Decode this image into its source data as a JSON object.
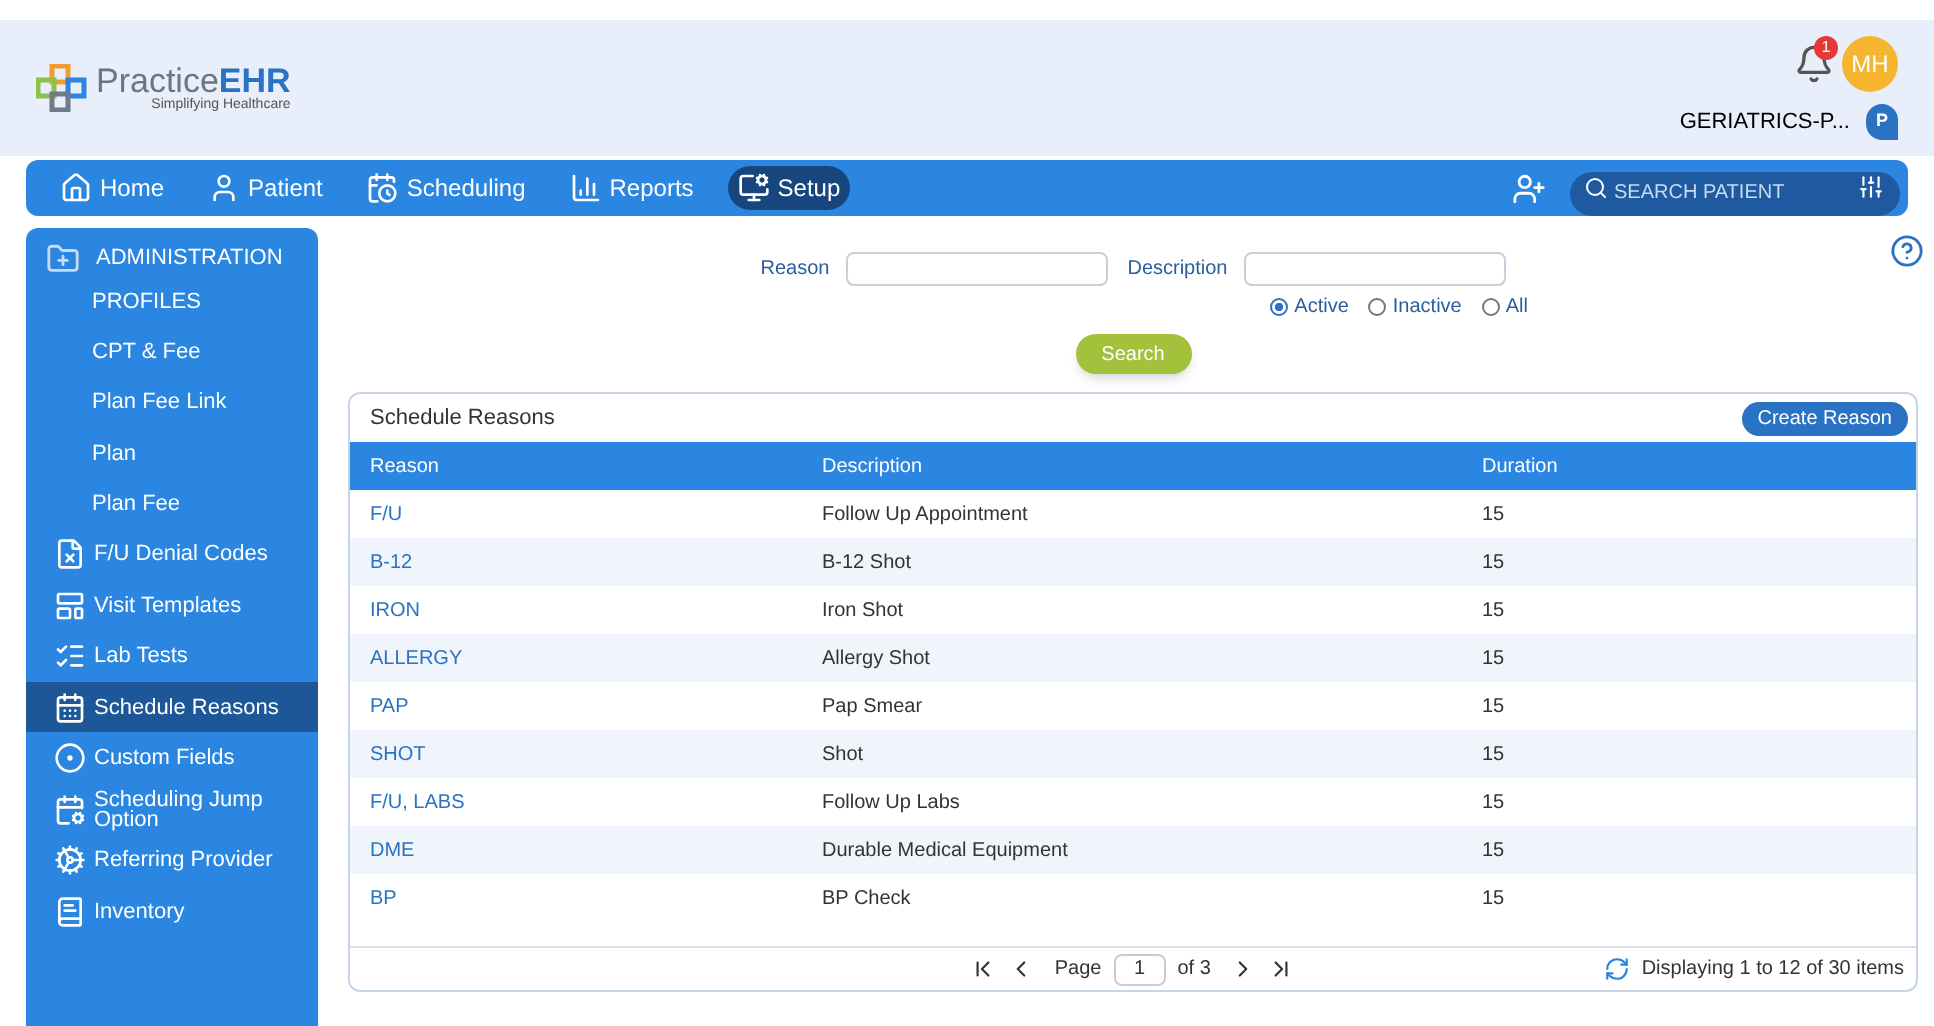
{
  "header": {
    "logo_main": "Practice",
    "logo_bold": "EHR",
    "tagline": "Simplifying Healthcare",
    "notifications": "1",
    "avatar": "MH",
    "facility": "GERIATRICS-P...",
    "facility_badge": "P"
  },
  "nav": {
    "items": [
      {
        "label": "Home",
        "selected": false
      },
      {
        "label": "Patient",
        "selected": false
      },
      {
        "label": "Scheduling",
        "selected": false
      },
      {
        "label": "Reports",
        "selected": false
      },
      {
        "label": "Setup",
        "selected": true
      }
    ],
    "search_placeholder": "SEARCH PATIENT"
  },
  "sidebar": {
    "heading": "ADMINISTRATION",
    "items": [
      {
        "label": "PROFILES",
        "selected": false
      },
      {
        "label": "CPT & Fee",
        "selected": false
      },
      {
        "label": "Plan Fee Link",
        "selected": false
      },
      {
        "label": "Plan",
        "selected": false
      },
      {
        "label": "Plan Fee",
        "selected": false
      },
      {
        "label": "F/U Denial Codes",
        "selected": false
      },
      {
        "label": "Visit Templates",
        "selected": false
      },
      {
        "label": "Lab Tests",
        "selected": false
      },
      {
        "label": "Schedule Reasons",
        "selected": true
      },
      {
        "label": "Custom Fields",
        "selected": false
      },
      {
        "label": "Scheduling Jump Option",
        "selected": false
      },
      {
        "label": "Referring Provider",
        "selected": false
      },
      {
        "label": "Inventory",
        "selected": false
      }
    ]
  },
  "filters": {
    "reason_label": "Reason",
    "description_label": "Description",
    "status": [
      {
        "label": "Active",
        "selected": true
      },
      {
        "label": "Inactive",
        "selected": false
      },
      {
        "label": "All",
        "selected": false
      }
    ],
    "search_button": "Search"
  },
  "table": {
    "title": "Schedule Reasons",
    "create_button": "Create Reason",
    "columns": [
      "Reason",
      "Description",
      "Duration"
    ],
    "rows": [
      [
        "F/U",
        "Follow Up Appointment",
        "15"
      ],
      [
        "B-12",
        "B-12 Shot",
        "15"
      ],
      [
        "IRON",
        "Iron Shot",
        "15"
      ],
      [
        "ALLERGY",
        "Allergy Shot",
        "15"
      ],
      [
        "PAP",
        "Pap Smear",
        "15"
      ],
      [
        "SHOT",
        "Shot",
        "15"
      ],
      [
        "F/U, LABS",
        "Follow Up Labs",
        "15"
      ],
      [
        "DME",
        "Durable Medical Equipment",
        "15"
      ],
      [
        "BP",
        "BP Check",
        "15"
      ]
    ],
    "pager": {
      "page_label": "Page",
      "page": "1",
      "of": "of 3",
      "summary": "Displaying 1 to 12 of 30 items"
    }
  }
}
